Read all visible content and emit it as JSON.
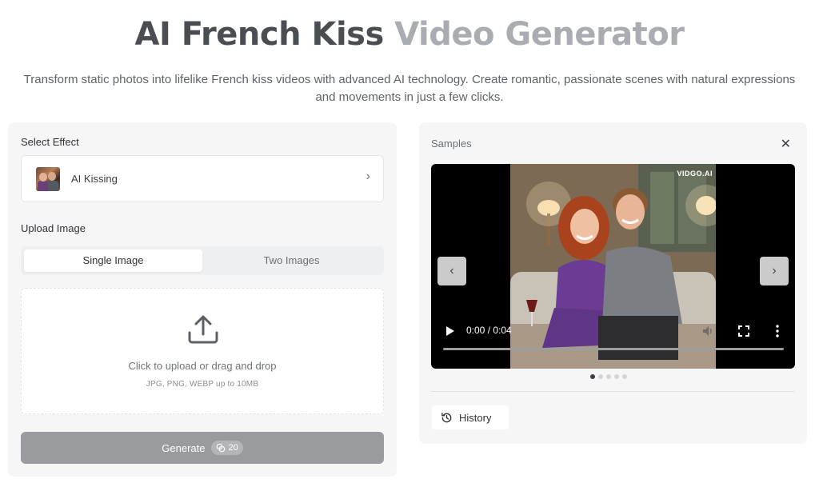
{
  "header": {
    "title_part1": "AI French Kiss",
    "title_part2": "Video Generator",
    "subtitle": "Transform static photos into lifelike French kiss videos with advanced AI technology. Create romantic, passionate scenes with natural expressions and movements in just a few clicks."
  },
  "left": {
    "effect_label": "Select Effect",
    "effect_name": "AI Kissing",
    "chevron": "›",
    "upload_label": "Upload Image",
    "tabs": [
      {
        "label": "Single Image",
        "active": true
      },
      {
        "label": "Two Images",
        "active": false
      }
    ],
    "upload_text": "Click to upload or drag and drop",
    "upload_hint": "JPG, PNG, WEBP up to 10MB",
    "generate_label": "Generate",
    "credits": "20"
  },
  "right": {
    "samples_label": "Samples",
    "close": "✕",
    "watermark": "VIDGO.AI",
    "prev": "‹",
    "next": "›",
    "time": "0:00 / 0:04",
    "dots": 5,
    "active_dot": 0,
    "history_label": "History"
  },
  "colors": {
    "accent_disabled": "#9a9b9e",
    "panel_bg": "#f6f6f7"
  }
}
